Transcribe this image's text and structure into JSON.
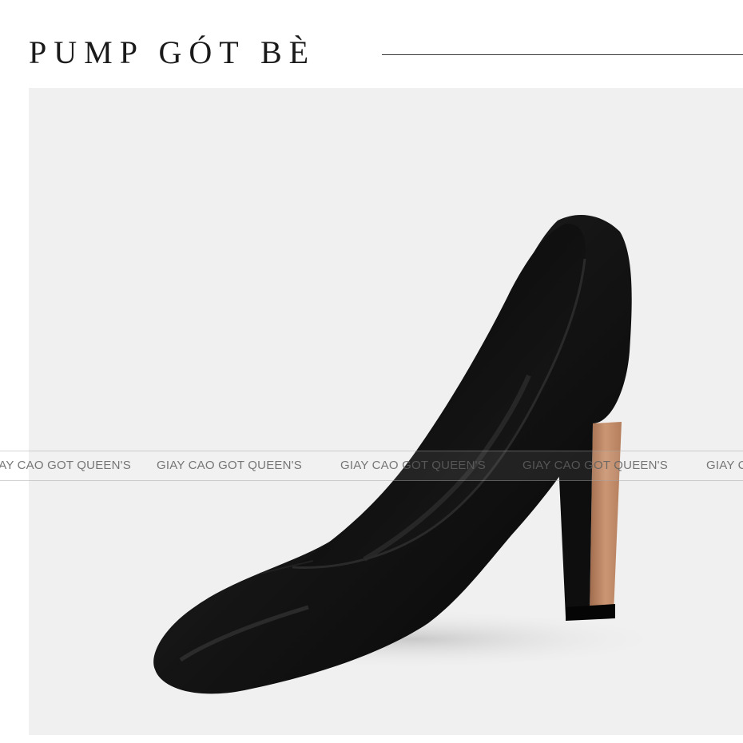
{
  "title": "PUMP GÓT BÈ",
  "watermark": {
    "text": "GIAY CAO GOT QUEEN'S"
  },
  "colors": {
    "background": "#ffffff",
    "photo_background": "#f0f0f0",
    "shoe_leather": "#121212",
    "heel_wood": "#c08b66"
  }
}
